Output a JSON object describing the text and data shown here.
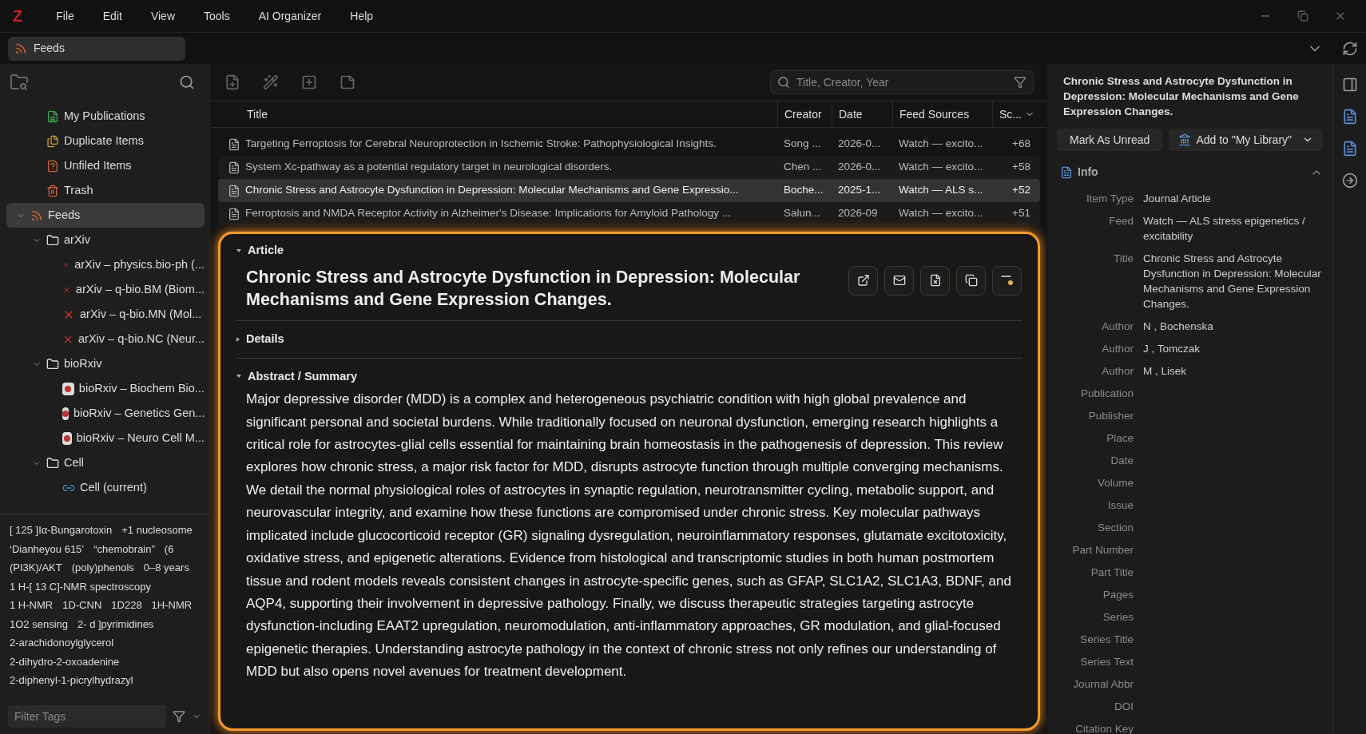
{
  "menu": [
    "File",
    "Edit",
    "View",
    "Tools",
    "AI Organizer",
    "Help"
  ],
  "tab": {
    "label": "Feeds"
  },
  "sidebar": {
    "items": [
      {
        "label": "My Publications",
        "kind": "publications",
        "selected": false
      },
      {
        "label": "Duplicate Items",
        "kind": "duplicates",
        "selected": false
      },
      {
        "label": "Unfiled Items",
        "kind": "unfiled",
        "selected": false
      },
      {
        "label": "Trash",
        "kind": "trash",
        "selected": false
      },
      {
        "label": "Feeds",
        "kind": "feeds",
        "selected": true,
        "expanded": true,
        "children": [
          {
            "label": "arXiv",
            "kind": "folder",
            "selected": false,
            "expanded": true,
            "children": [
              {
                "label": "arXiv – physics.bio-ph (...",
                "kind": "arxiv",
                "selected": false
              },
              {
                "label": "arXiv – q-bio.BM (Biom...",
                "kind": "arxiv",
                "selected": false
              },
              {
                "label": "arXiv – q-bio.MN (Mol...",
                "kind": "arxiv",
                "selected": false
              },
              {
                "label": "arXiv – q-bio.NC (Neur...",
                "kind": "arxiv",
                "selected": false
              }
            ]
          },
          {
            "label": "bioRxiv",
            "kind": "folder",
            "selected": false,
            "expanded": true,
            "children": [
              {
                "label": "bioRxiv – Biochem Bio...",
                "kind": "biorxiv",
                "selected": false
              },
              {
                "label": "bioRxiv – Genetics Gen...",
                "kind": "biorxiv",
                "selected": false
              },
              {
                "label": "bioRxiv – Neuro Cell M...",
                "kind": "biorxiv",
                "selected": false
              }
            ]
          },
          {
            "label": "Cell",
            "kind": "folder",
            "selected": false,
            "expanded": true,
            "children": [
              {
                "label": "Cell (current)",
                "kind": "link",
                "selected": false
              }
            ]
          }
        ]
      }
    ]
  },
  "tags": [
    [
      "[ 125 ]Iα-Bungarotoxin",
      "+1 nucleosome"
    ],
    [
      "‘Dianheyou 615’",
      "“chemobrain”",
      "(6"
    ],
    [
      "(PI3K)/AKT",
      "(poly)phenols",
      "0–8 years"
    ],
    [
      "1 H-[ 13 C]-NMR spectroscopy"
    ],
    [
      "1 H-NMR",
      "1D-CNN",
      "1D228",
      "1H-NMR"
    ],
    [
      "1O2 sensing",
      "2- d ]pyrimidines"
    ],
    [
      "2-arachidonoylglycerol"
    ],
    [
      "2-dihydro-2-oxoadenine"
    ],
    [
      "2-diphenyl-1-picrylhydrazyl"
    ]
  ],
  "tag_filter": {
    "placeholder": "Filter Tags"
  },
  "search": {
    "placeholder": "Title, Creator, Year"
  },
  "table": {
    "columns": [
      "Title",
      "Creator",
      "Date",
      "Feed Sources",
      "Sc..."
    ],
    "rows": [
      {
        "cells": [
          "Targeting Ferroptosis for Cerebral Neuroprotection in Ischemic Stroke: Pathophysiological Insights.",
          "Song ...",
          "2026-0...",
          "Watch — excito...",
          "+68"
        ],
        "selected": false
      },
      {
        "cells": [
          "System Xc-pathway as a potential regulatory target in neurological disorders.",
          "Chen ...",
          "2026-0...",
          "Watch — excito...",
          "+58"
        ],
        "selected": false
      },
      {
        "cells": [
          "Chronic Stress and Astrocyte Dysfunction in Depression: Molecular Mechanisms and Gene Expressio...",
          "Boche...",
          "2025-1...",
          "Watch — ALS s...",
          "+52"
        ],
        "selected": true
      },
      {
        "cells": [
          "Ferroptosis and NMDA Receptor Activity in Alzheimer's Disease: Implications for Amyloid Pathology ...",
          "Salun...",
          "2026-09",
          "Watch — excito...",
          "+51"
        ],
        "selected": false
      }
    ]
  },
  "article": {
    "sections": [
      {
        "heading": "Article",
        "expanded": true
      },
      {
        "heading": "Details",
        "expanded": false
      },
      {
        "heading": "Abstract / Summary",
        "expanded": true
      }
    ],
    "title": "Chronic Stress and Astrocyte Dysfunction in Depression: Molecular Mechanisms and Gene Expression Changes.",
    "abstract": "Major depressive disorder (MDD) is a complex and heterogeneous psychiatric condition with high global prevalence and significant personal and societal burdens. While traditionally focused on neuronal dysfunction, emerging research highlights a critical role for astrocytes-glial cells essential for maintaining brain homeostasis in the pathogenesis of depression. This review explores how chronic stress, a major risk factor for MDD, disrupts astrocyte function through multiple converging mechanisms. We detail the normal physiological roles of astrocytes in synaptic regulation, neurotransmitter cycling, metabolic support, and neurovascular integrity, and examine how these functions are compromised under chronic stress. Key molecular pathways implicated include glucocorticoid receptor (GR) signaling dysregulation, neuroinflammatory responses, glutamate excitotoxicity, oxidative stress, and epigenetic alterations. Evidence from histological and transcriptomic studies in both human postmortem tissue and rodent models reveals consistent changes in astrocyte-specific genes, such as GFAP, SLC1A2, SLC1A3, BDNF, and AQP4, supporting their involvement in depressive pathology. Finally, we discuss therapeutic strategies targeting astrocyte dysfunction-including EAAT2 upregulation, neuromodulation, anti-inflammatory approaches, GR modulation, and glial-focused epigenetic therapies. Understanding astrocyte pathology in the context of chronic stress not only refines our understanding of MDD but also opens novel avenues for treatment development."
  },
  "item_pane": {
    "title": "Chronic Stress and Astrocyte Dysfunction in Depression: Molecular Mechanisms and Gene Expression Changes.",
    "buttons": [
      "Mark As Unread",
      "Add to \"My Library\""
    ],
    "section": {
      "heading": "Info",
      "expanded": true
    },
    "fields": [
      {
        "label": "Item Type",
        "value": "Journal Article"
      },
      {
        "label": "Feed",
        "value": "Watch — ALS stress epigenetics / excitability"
      },
      {
        "label": "Title",
        "value": "Chronic Stress and Astrocyte Dysfunction in Depression: Molecular Mechanisms and Gene Expression Changes."
      },
      {
        "label": "Author",
        "value": "N , Bochenska"
      },
      {
        "label": "Author",
        "value": "J , Tomczak"
      },
      {
        "label": "Author",
        "value": "M , Lisek"
      },
      {
        "label": "Publication"
      },
      {
        "label": "Publisher"
      },
      {
        "label": "Place"
      },
      {
        "label": "Date"
      },
      {
        "label": "Volume"
      },
      {
        "label": "Issue"
      },
      {
        "label": "Section"
      },
      {
        "label": "Part Number"
      },
      {
        "label": "Part Title"
      },
      {
        "label": "Pages"
      },
      {
        "label": "Series"
      },
      {
        "label": "Series Title"
      },
      {
        "label": "Series Text"
      },
      {
        "label": "Journal Abbr"
      },
      {
        "label": "DOI"
      },
      {
        "label": "Citation Key"
      }
    ]
  },
  "logo": "Z"
}
